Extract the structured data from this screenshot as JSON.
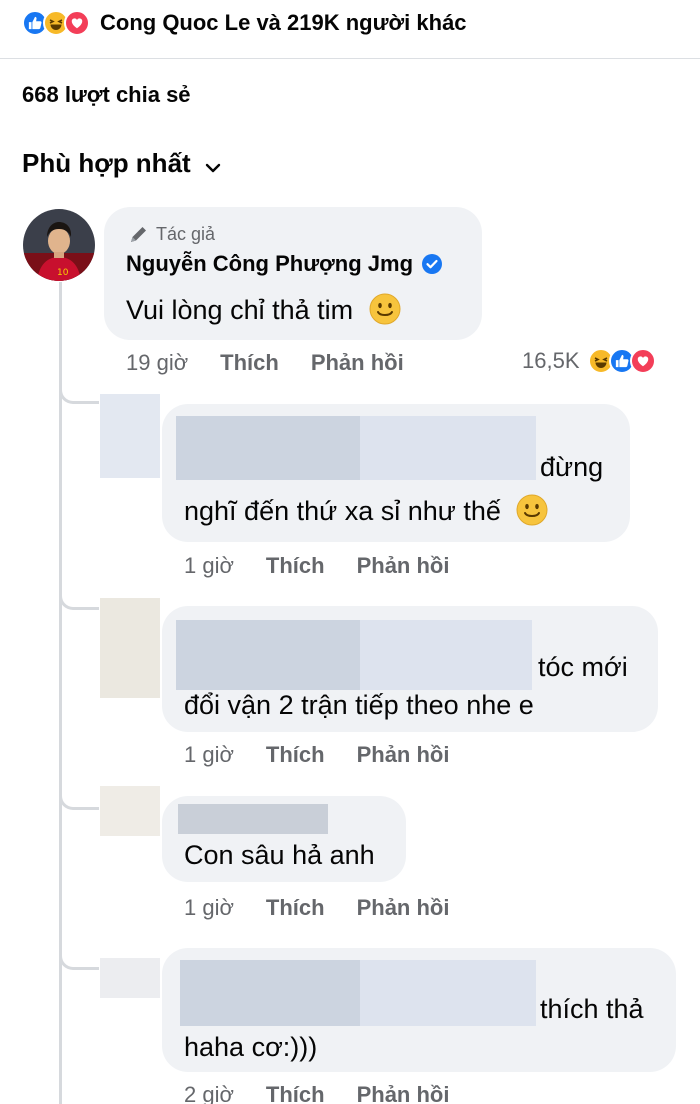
{
  "reactions_summary": {
    "text": "Cong Quoc Le và 219K người khác",
    "icons": [
      "like-icon",
      "haha-icon",
      "love-icon"
    ],
    "colors": {
      "like": "#1877f2",
      "haha": "#f7b928",
      "love": "#f33e58"
    }
  },
  "shares": {
    "text": "668 lượt chia sẻ"
  },
  "sort": {
    "label": "Phù hợp nhất",
    "icon": "chevron-down-icon"
  },
  "main_comment": {
    "author_badge": "Tác giả",
    "author_name": "Nguyễn Công Phượng Jmg",
    "verified": true,
    "text": "Vui lòng chỉ thả tim",
    "emoji": "slightly-smiling-face-icon",
    "time": "19 giờ",
    "like_label": "Thích",
    "reply_label": "Phản hồi",
    "reaction_count": "16,5K",
    "reaction_icons": [
      "haha-icon",
      "like-icon",
      "love-icon"
    ]
  },
  "replies": [
    {
      "line1": "đừng",
      "line2": "nghĩ đến thứ xa sỉ như thế",
      "emoji": "slightly-smiling-face-icon",
      "time": "1 giờ",
      "like_label": "Thích",
      "reply_label": "Phản hồi"
    },
    {
      "line1": "tóc mới",
      "line2": "đổi vận 2 trận tiếp theo nhe e",
      "time": "1 giờ",
      "like_label": "Thích",
      "reply_label": "Phản hồi"
    },
    {
      "line1": "Con sâu hả anh",
      "time": "1 giờ",
      "like_label": "Thích",
      "reply_label": "Phản hồi"
    },
    {
      "line1": "thích thả",
      "line2": "haha cơ:)))",
      "time": "2 giờ",
      "like_label": "Thích",
      "reply_label": "Phản hồi"
    }
  ]
}
